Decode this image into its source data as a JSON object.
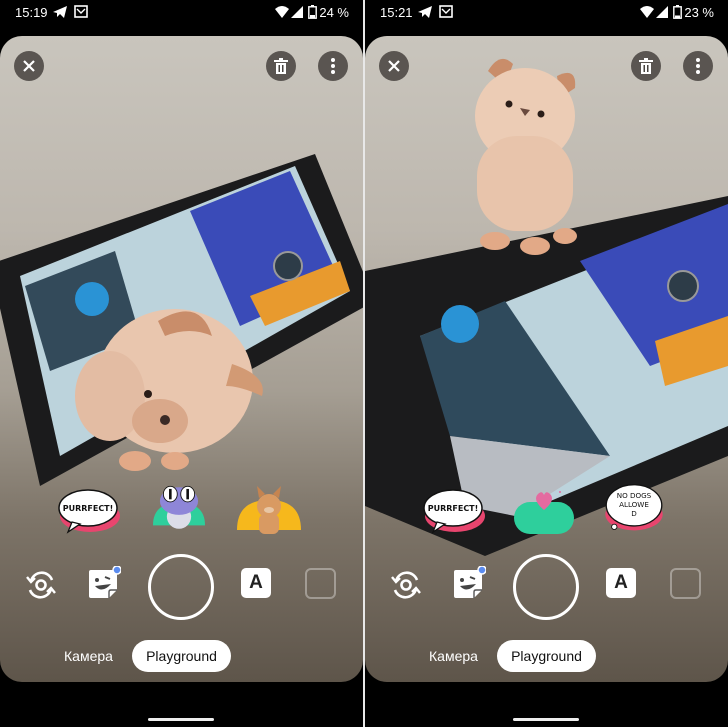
{
  "panels": [
    {
      "status": {
        "time": "15:19",
        "battery": "24 %"
      },
      "top_actions": {
        "close": "close-icon",
        "delete": "trash-icon",
        "more": "more-vert-icon"
      },
      "stickers": [
        {
          "name": "purrfect-bubble-sticker",
          "text": "PURRFECT!"
        },
        {
          "name": "owl-character-sticker",
          "text": ""
        },
        {
          "name": "french-bulldog-sticker",
          "text": ""
        }
      ],
      "controls": {
        "text_button": "A"
      },
      "modes": {
        "camera": "Камера",
        "playground": "Playground",
        "active": "Playground"
      }
    },
    {
      "status": {
        "time": "15:21",
        "battery": "23 %"
      },
      "top_actions": {
        "close": "close-icon",
        "delete": "trash-icon",
        "more": "more-vert-icon"
      },
      "stickers": [
        {
          "name": "purrfect-bubble-sticker",
          "text": "PURRFECT!"
        },
        {
          "name": "heart-blob-sticker",
          "text": ""
        },
        {
          "name": "no-dogs-bubble-sticker",
          "text": "NO DOGS ALLOWE D"
        }
      ],
      "controls": {
        "text_button": "A"
      },
      "modes": {
        "camera": "Камера",
        "playground": "Playground",
        "active": "Playground"
      }
    }
  ],
  "colors": {
    "sticker_pink": "#e8456e",
    "sticker_teal": "#2ecf9c",
    "sticker_yellow": "#f6b81c",
    "badge_blue": "#5b8cf0"
  }
}
